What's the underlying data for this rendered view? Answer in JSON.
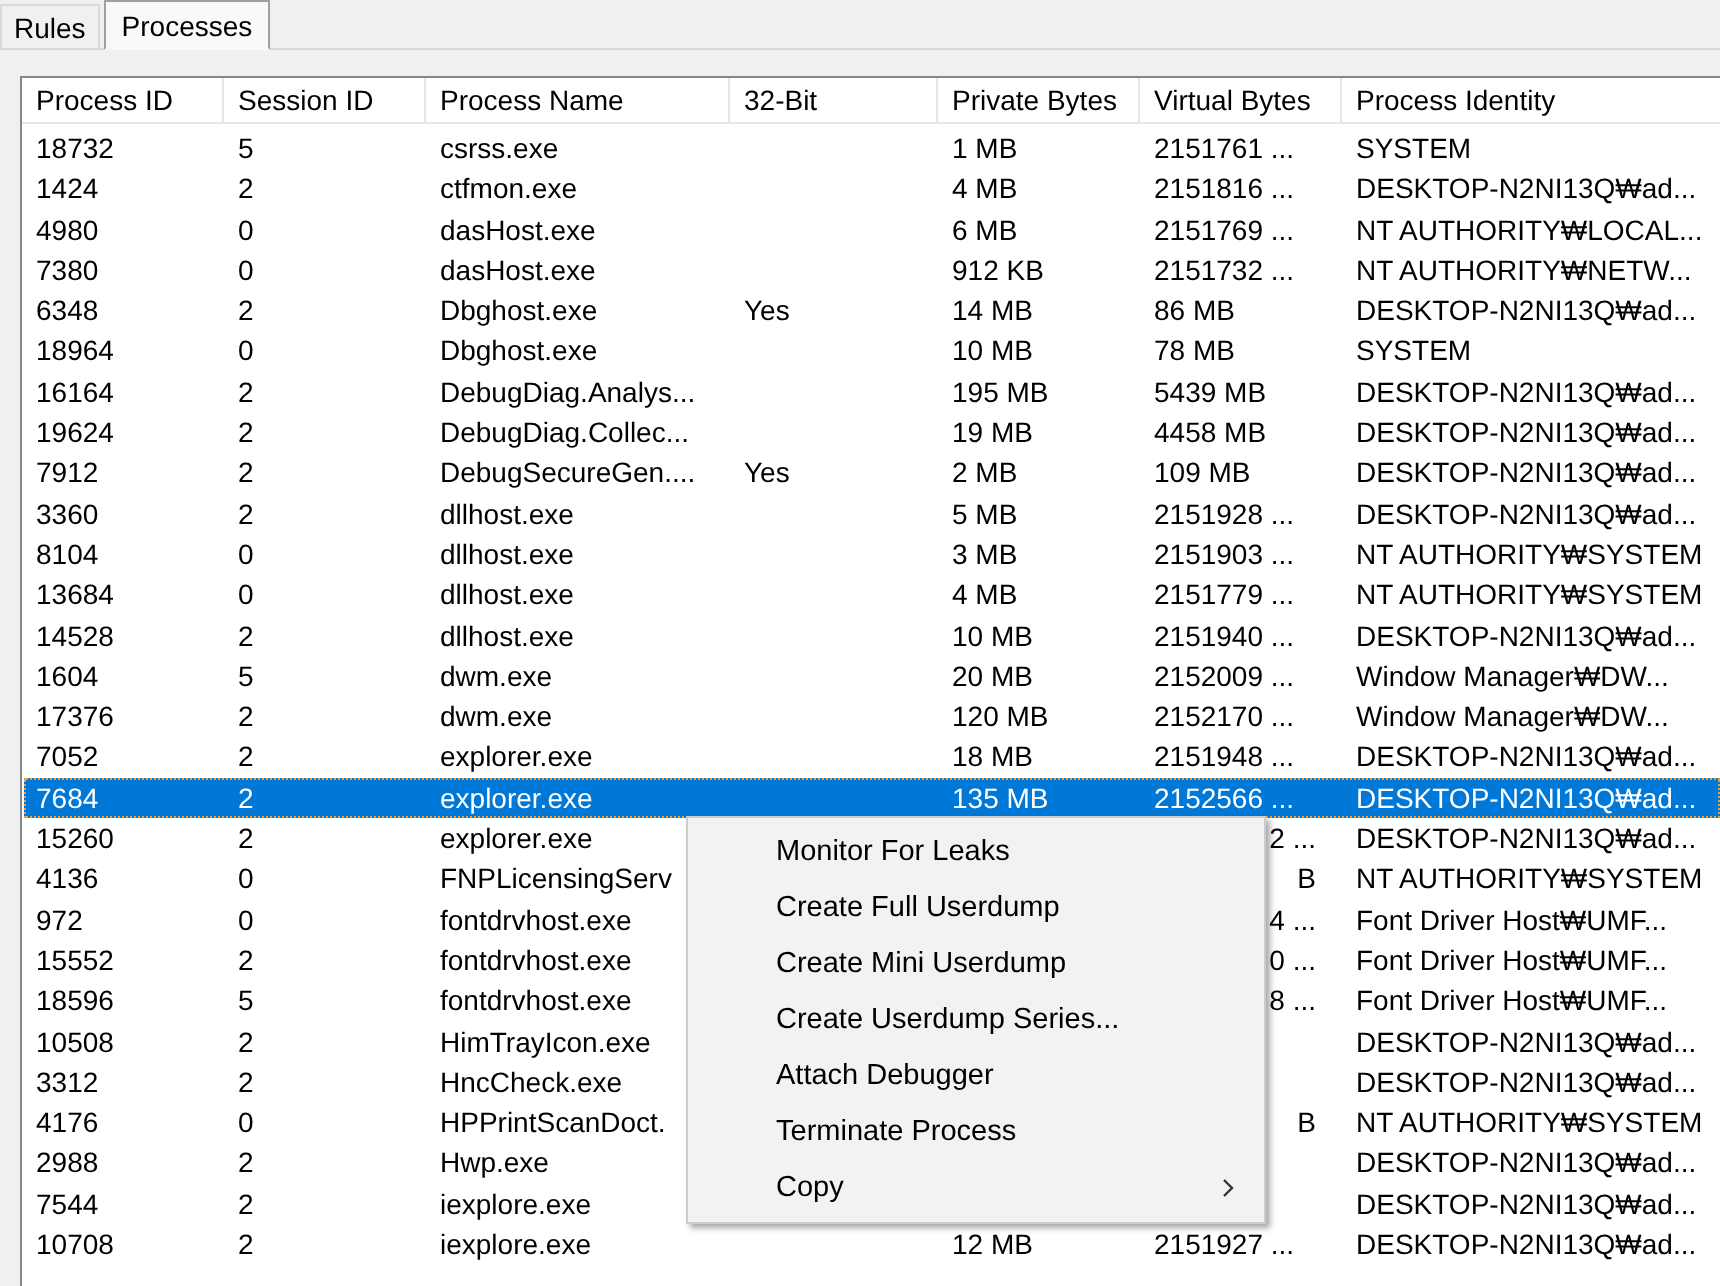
{
  "tabs": [
    {
      "label": "Rules",
      "selected": false
    },
    {
      "label": "Processes",
      "selected": true
    }
  ],
  "table": {
    "columns": [
      "Process ID",
      "Session ID",
      "Process Name",
      "32-Bit",
      "Private Bytes",
      "Virtual Bytes",
      "Process Identity"
    ],
    "rows": [
      {
        "process_id": "18732",
        "session_id": "5",
        "process_name": "csrss.exe",
        "private_bytes": "1 MB",
        "virtual_bytes": "2151761 ...",
        "process_identity": "SYSTEM",
        "selected": false
      },
      {
        "process_id": "1424",
        "session_id": "2",
        "process_name": "ctfmon.exe",
        "private_bytes": "4 MB",
        "virtual_bytes": "2151816 ...",
        "process_identity": "DESKTOP-N2NI13Q₩ad...",
        "selected": false
      },
      {
        "process_id": "4980",
        "session_id": "0",
        "process_name": "dasHost.exe",
        "private_bytes": "6 MB",
        "virtual_bytes": "2151769 ...",
        "process_identity": "NT AUTHORITY₩LOCAL...",
        "selected": false
      },
      {
        "process_id": "7380",
        "session_id": "0",
        "process_name": "dasHost.exe",
        "private_bytes": "912 KB",
        "virtual_bytes": "2151732 ...",
        "process_identity": "NT AUTHORITY₩NETW...",
        "selected": false
      },
      {
        "process_id": "6348",
        "session_id": "2",
        "process_name": "Dbghost.exe",
        "bit32": "Yes",
        "private_bytes": "14 MB",
        "virtual_bytes": "86 MB",
        "process_identity": "DESKTOP-N2NI13Q₩ad...",
        "selected": false
      },
      {
        "process_id": "18964",
        "session_id": "0",
        "process_name": "Dbghost.exe",
        "private_bytes": "10 MB",
        "virtual_bytes": "78 MB",
        "process_identity": "SYSTEM",
        "selected": false
      },
      {
        "process_id": "16164",
        "session_id": "2",
        "process_name": "DebugDiag.Analys...",
        "private_bytes": "195 MB",
        "virtual_bytes": "5439 MB",
        "process_identity": "DESKTOP-N2NI13Q₩ad...",
        "selected": false
      },
      {
        "process_id": "19624",
        "session_id": "2",
        "process_name": "DebugDiag.Collec...",
        "private_bytes": "19 MB",
        "virtual_bytes": "4458 MB",
        "process_identity": "DESKTOP-N2NI13Q₩ad...",
        "selected": false
      },
      {
        "process_id": "7912",
        "session_id": "2",
        "process_name": "DebugSecureGen....",
        "bit32": "Yes",
        "private_bytes": "2 MB",
        "virtual_bytes": "109 MB",
        "process_identity": "DESKTOP-N2NI13Q₩ad...",
        "selected": false
      },
      {
        "process_id": "3360",
        "session_id": "2",
        "process_name": "dllhost.exe",
        "private_bytes": "5 MB",
        "virtual_bytes": "2151928 ...",
        "process_identity": "DESKTOP-N2NI13Q₩ad...",
        "selected": false
      },
      {
        "process_id": "8104",
        "session_id": "0",
        "process_name": "dllhost.exe",
        "private_bytes": "3 MB",
        "virtual_bytes": "2151903 ...",
        "process_identity": "NT AUTHORITY₩SYSTEM",
        "selected": false
      },
      {
        "process_id": "13684",
        "session_id": "0",
        "process_name": "dllhost.exe",
        "private_bytes": "4 MB",
        "virtual_bytes": "2151779 ...",
        "process_identity": "NT AUTHORITY₩SYSTEM",
        "selected": false
      },
      {
        "process_id": "14528",
        "session_id": "2",
        "process_name": "dllhost.exe",
        "private_bytes": "10 MB",
        "virtual_bytes": "2151940 ...",
        "process_identity": "DESKTOP-N2NI13Q₩ad...",
        "selected": false
      },
      {
        "process_id": "1604",
        "session_id": "5",
        "process_name": "dwm.exe",
        "private_bytes": "20 MB",
        "virtual_bytes": "2152009 ...",
        "process_identity": "Window Manager₩DW...",
        "selected": false
      },
      {
        "process_id": "17376",
        "session_id": "2",
        "process_name": "dwm.exe",
        "private_bytes": "120 MB",
        "virtual_bytes": "2152170 ...",
        "process_identity": "Window Manager₩DW...",
        "selected": false
      },
      {
        "process_id": "7052",
        "session_id": "2",
        "process_name": "explorer.exe",
        "private_bytes": "18 MB",
        "virtual_bytes": "2151948 ...",
        "process_identity": "DESKTOP-N2NI13Q₩ad...",
        "selected": false
      },
      {
        "process_id": "7684",
        "session_id": "2",
        "process_name": "explorer.exe",
        "private_bytes": "135 MB",
        "virtual_bytes": "2152566 ...",
        "process_identity": "DESKTOP-N2NI13Q₩ad...",
        "selected": true
      },
      {
        "process_id": "15260",
        "session_id": "2",
        "process_name": "explorer.exe",
        "virtual_bytes_tail": "2 ...",
        "process_identity": "DESKTOP-N2NI13Q₩ad...",
        "selected": false
      },
      {
        "process_id": "4136",
        "session_id": "0",
        "process_name": "FNPLicensingServ",
        "virtual_bytes_tail": "B",
        "process_identity": "NT AUTHORITY₩SYSTEM",
        "selected": false
      },
      {
        "process_id": "972",
        "session_id": "0",
        "process_name": "fontdrvhost.exe",
        "virtual_bytes_tail": "4 ...",
        "process_identity": "Font Driver Host₩UMF...",
        "selected": false
      },
      {
        "process_id": "15552",
        "session_id": "2",
        "process_name": "fontdrvhost.exe",
        "virtual_bytes_tail": "0 ...",
        "process_identity": "Font Driver Host₩UMF...",
        "selected": false
      },
      {
        "process_id": "18596",
        "session_id": "5",
        "process_name": "fontdrvhost.exe",
        "virtual_bytes_tail": "8 ...",
        "process_identity": "Font Driver Host₩UMF...",
        "selected": false
      },
      {
        "process_id": "10508",
        "session_id": "2",
        "process_name": "HimTrayIcon.exe",
        "process_identity": "DESKTOP-N2NI13Q₩ad...",
        "selected": false
      },
      {
        "process_id": "3312",
        "session_id": "2",
        "process_name": "HncCheck.exe",
        "process_identity": "DESKTOP-N2NI13Q₩ad...",
        "selected": false
      },
      {
        "process_id": "4176",
        "session_id": "0",
        "process_name": "HPPrintScanDoct.",
        "virtual_bytes_tail": "B",
        "process_identity": "NT AUTHORITY₩SYSTEM",
        "selected": false
      },
      {
        "process_id": "2988",
        "session_id": "2",
        "process_name": "Hwp.exe",
        "process_identity": "DESKTOP-N2NI13Q₩ad...",
        "selected": false
      },
      {
        "process_id": "7544",
        "session_id": "2",
        "process_name": "iexplore.exe",
        "process_identity": "DESKTOP-N2NI13Q₩ad...",
        "selected": false
      },
      {
        "process_id": "10708",
        "session_id": "2",
        "process_name": "iexplore.exe",
        "private_bytes": "12 MB",
        "virtual_bytes": "2151927 ...",
        "process_identity": "DESKTOP-N2NI13Q₩ad...",
        "selected": false
      }
    ]
  },
  "context_menu": {
    "items": [
      {
        "label": "Monitor For Leaks",
        "submenu": false
      },
      {
        "label": "Create Full Userdump",
        "submenu": false
      },
      {
        "label": "Create Mini Userdump",
        "submenu": false
      },
      {
        "label": "Create Userdump Series...",
        "submenu": false
      },
      {
        "label": "Attach Debugger",
        "submenu": false
      },
      {
        "label": "Terminate Process",
        "submenu": false
      },
      {
        "label": "Copy",
        "submenu": true
      }
    ]
  }
}
